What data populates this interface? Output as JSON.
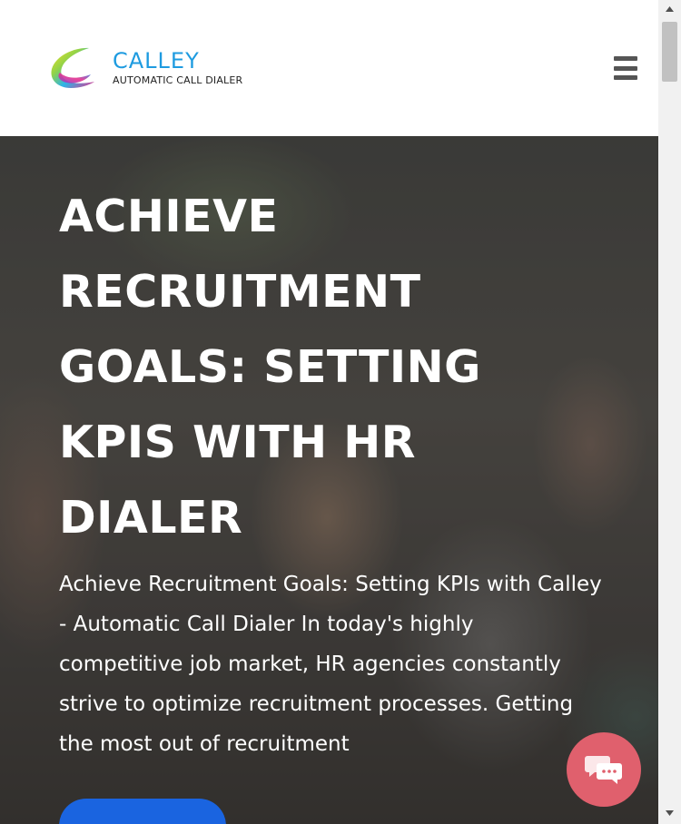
{
  "header": {
    "logo_name": "CALLEY",
    "logo_tagline": "AUTOMATIC CALL DIALER",
    "menu_icon": "hamburger-menu-icon"
  },
  "hero": {
    "title": "ACHIEVE RECRUITMENT GOALS: SETTING KPIS WITH HR DIALER",
    "text": "Achieve Recruitment Goals: Setting KPIs with Calley - Automatic Call Dialer In today's highly competitive job market, HR agencies constantly strive to optimize recruitment processes. Getting the most out of recruitment",
    "button_color": "#1a64e0"
  },
  "chat": {
    "icon": "chat-bubbles-icon",
    "color": "#e0606d"
  },
  "colors": {
    "brand": "#1e9be0"
  }
}
